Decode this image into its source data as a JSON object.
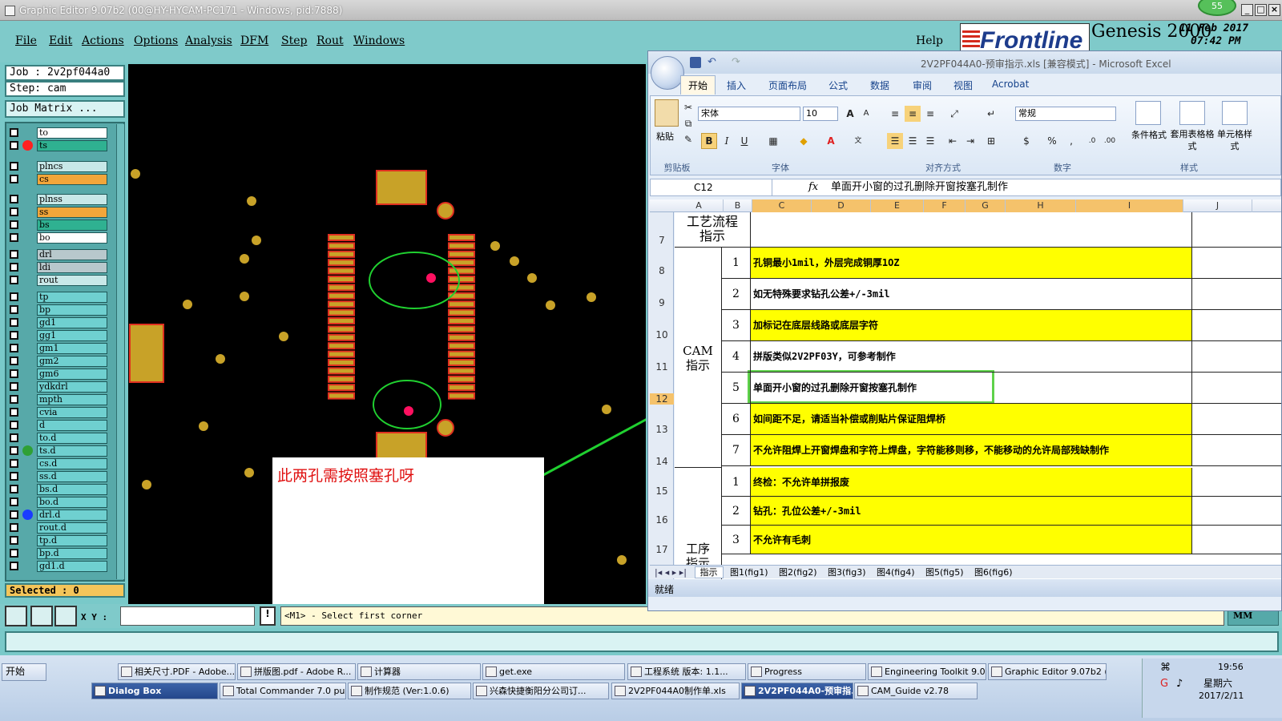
{
  "titlebar": {
    "title": "Graphic Editor 9.07b2 (00@HY-HYCAM-PC171 - Windows, pid:7888)",
    "badge": "55"
  },
  "menu": {
    "items": [
      "File",
      "Edit",
      "Actions",
      "Options",
      "Analysis",
      "DFM",
      "Step",
      "Rout",
      "Windows"
    ],
    "help": "Help"
  },
  "brand": {
    "logo": "Frontline",
    "product": "Genesis 2000",
    "date": "11 Feb 2017",
    "time": "07:42 PM"
  },
  "job": {
    "job_label": "Job  : 2v2pf044a0",
    "step_label": "Step: cam",
    "matrix_btn": "Job Matrix ..."
  },
  "layers": [
    {
      "name": "to",
      "color": "#ffffff",
      "dot": ""
    },
    {
      "name": "ts",
      "color": "#2fb191",
      "dot": "#ff2020"
    },
    {
      "name": "plncs",
      "color": "#c8e8e8",
      "dot": ""
    },
    {
      "name": "cs",
      "color": "#f3a63a",
      "dot": ""
    },
    {
      "name": "plnss",
      "color": "#c8e8e8",
      "dot": ""
    },
    {
      "name": "ss",
      "color": "#f3a63a",
      "dot": ""
    },
    {
      "name": "bs",
      "color": "#2fb191",
      "dot": ""
    },
    {
      "name": "bo",
      "color": "#ffffff",
      "dot": ""
    },
    {
      "name": "drl",
      "color": "#b8c8cc",
      "dot": ""
    },
    {
      "name": "ldi",
      "color": "#b8c8cc",
      "dot": ""
    },
    {
      "name": "rout",
      "color": "#c8e8e8",
      "dot": ""
    },
    {
      "name": "tp",
      "color": "#6fd0d0",
      "dot": ""
    },
    {
      "name": "bp",
      "color": "#6fd0d0",
      "dot": ""
    },
    {
      "name": "gd1",
      "color": "#6fd0d0",
      "dot": ""
    },
    {
      "name": "gg1",
      "color": "#6fd0d0",
      "dot": ""
    },
    {
      "name": "gm1",
      "color": "#6fd0d0",
      "dot": ""
    },
    {
      "name": "gm2",
      "color": "#6fd0d0",
      "dot": ""
    },
    {
      "name": "gm6",
      "color": "#6fd0d0",
      "dot": ""
    },
    {
      "name": "ydkdrl",
      "color": "#6fd0d0",
      "dot": ""
    },
    {
      "name": "mpth",
      "color": "#6fd0d0",
      "dot": ""
    },
    {
      "name": "cvia",
      "color": "#6fd0d0",
      "dot": ""
    },
    {
      "name": "d",
      "color": "#6fd0d0",
      "dot": ""
    },
    {
      "name": "to.d",
      "color": "#6fd0d0",
      "dot": ""
    },
    {
      "name": "ts.d",
      "color": "#6fd0d0",
      "dot": "#2fa035"
    },
    {
      "name": "cs.d",
      "color": "#6fd0d0",
      "dot": ""
    },
    {
      "name": "ss.d",
      "color": "#6fd0d0",
      "dot": ""
    },
    {
      "name": "bs.d",
      "color": "#6fd0d0",
      "dot": ""
    },
    {
      "name": "bo.d",
      "color": "#6fd0d0",
      "dot": ""
    },
    {
      "name": "drl.d",
      "color": "#6fd0d0",
      "dot": "#1a3cff"
    },
    {
      "name": "rout.d",
      "color": "#6fd0d0",
      "dot": ""
    },
    {
      "name": "tp.d",
      "color": "#6fd0d0",
      "dot": ""
    },
    {
      "name": "bp.d",
      "color": "#6fd0d0",
      "dot": ""
    },
    {
      "name": "gd1.d",
      "color": "#6fd0d0",
      "dot": ""
    }
  ],
  "selected": "Selected : 0",
  "canvas": {
    "annotation": "此两孔需按照塞孔呀"
  },
  "bottom": {
    "xy_label": "X Y :",
    "xy_value": "",
    "message": "<M1> - Select first corner",
    "unit": "MM"
  },
  "excel": {
    "title": "2V2PF044A0-预审指示.xls  [兼容模式] - Microsoft Excel",
    "tabs": [
      "开始",
      "插入",
      "页面布局",
      "公式",
      "数据",
      "审阅",
      "视图",
      "Acrobat"
    ],
    "ribbon": {
      "paste": "粘贴",
      "clipboard": "剪贴板",
      "font_name": "宋体",
      "font_size": "10",
      "font_group": "字体",
      "align_group": "对齐方式",
      "number_format": "常规",
      "number_group": "数字",
      "cond_format": "条件格式",
      "table_format": "套用表格格式",
      "cell_style": "单元格样式",
      "style_group": "样式"
    },
    "namebox": "C12",
    "formula": "单面开小窗的过孔删除开窗按塞孔制作",
    "columns": [
      "A",
      "B",
      "C",
      "D",
      "E",
      "F",
      "G",
      "H",
      "I",
      "J"
    ],
    "rows": [
      "7",
      "8",
      "9",
      "10",
      "11",
      "12",
      "13",
      "14",
      "15",
      "16",
      "17"
    ],
    "header_cell": "工艺流程指示",
    "cam_label": "CAM指示",
    "process_label": "工序指示",
    "cam_items": [
      {
        "n": "1",
        "text": "孔铜最小1mil，外层完成铜厚1OZ",
        "yellow": true
      },
      {
        "n": "2",
        "text": "如无特殊要求钻孔公差+/-3mil",
        "yellow": false
      },
      {
        "n": "3",
        "text": "加标记在底层线路或底层字符",
        "yellow": true
      },
      {
        "n": "4",
        "text": "拼版类似2V2PF03Y，可参考制作",
        "yellow": false
      },
      {
        "n": "5",
        "text": "单面开小窗的过孔删除开窗按塞孔制作",
        "yellow": false
      },
      {
        "n": "6",
        "text": "如间距不足，请适当补偿或削贴片保证阻焊桥",
        "yellow": true
      },
      {
        "n": "7",
        "text": "不允许阻焊上开窗焊盘和字符上焊盘，字符能移则移，不能移动的允许局部残缺制作",
        "yellow": true
      }
    ],
    "proc_items": [
      {
        "n": "1",
        "text": "终检：不允许单拼报废",
        "yellow": true
      },
      {
        "n": "2",
        "text": "钻孔：孔位公差+/-3mil",
        "yellow": true
      },
      {
        "n": "3",
        "text": "不允许有毛刺",
        "yellow": true
      }
    ],
    "sheet_tabs": [
      "指示",
      "图1(fig1)",
      "图2(fig2)",
      "图3(fig3)",
      "图4(fig4)",
      "图5(fig5)",
      "图6(fig6)"
    ],
    "status": "就绪"
  },
  "taskbar": {
    "start": "开始",
    "row1": [
      "相关尺寸.PDF - Adobe...",
      "拼版图.pdf - Adobe R...",
      "计算器",
      "get.exe",
      "工程系统  版本: 1.1...",
      "Progress",
      "Engineering Toolkit 9.0...",
      "Graphic Editor 9.07b2 (..."
    ],
    "row2": [
      "Dialog Box",
      "Total Commander 7.0 pu...",
      "制作规范 (Ver:1.0.6)",
      "兴森快捷衡阳分公司订...",
      "2V2PF044A0制作单.xls",
      "2V2PF044A0-预审指...",
      "CAM_Guide v2.78"
    ],
    "clock": "19:56",
    "weekday": "星期六",
    "date": "2017/2/11"
  }
}
